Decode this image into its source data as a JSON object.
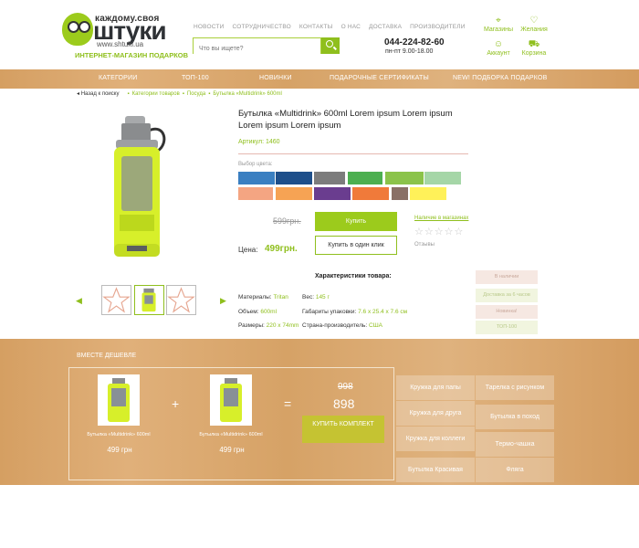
{
  "header": {
    "logo_top": "каждому.своя",
    "logo_main": "штуки",
    "logo_url": "www.shtuki.ua",
    "logo_sub": "ИНТЕРНЕТ-МАГАЗИН ПОДАРКОВ",
    "topnav": [
      "НОВОСТИ",
      "СОТРУДНИЧЕСТВО",
      "КОНТАКТЫ",
      "О НАС",
      "ДОСТАВКА",
      "ПРОИЗВОДИТЕЛИ"
    ],
    "search_placeholder": "Что вы ищете?",
    "phone": "044-224-82-60",
    "hours": "пн-пт 9.00-18.00",
    "icons": [
      {
        "label": "Магазины",
        "icon": "map-pin-icon",
        "glyph": "⌖"
      },
      {
        "label": "Желания",
        "icon": "heart-icon",
        "glyph": "♡"
      },
      {
        "label": "Аккаунт",
        "icon": "user-icon",
        "glyph": "☺"
      },
      {
        "label": "Корзина",
        "icon": "cart-icon",
        "glyph": "⛟"
      }
    ]
  },
  "nav": [
    "КАТЕГОРИИ",
    "ТОП-100",
    "НОВИНКИ",
    "ПОДАРОЧНЫЕ СЕРТИФИКАТЫ",
    "NEW! ПОДБОРКА ПОДАРКОВ"
  ],
  "breadcrumb": {
    "back": "Назад к поиску",
    "items": [
      "Категории товаров",
      "Посуда",
      "Бутылка «Multidrink» 600ml"
    ]
  },
  "product": {
    "title": "Бутылка «Multidrink» 600ml Lorem ipsum Lorem ipsum Lorem ipsum Lorem ipsum",
    "sku": "Артикул: 1460",
    "color_label": "Выбор цвета:",
    "colors": [
      "#3a7fc1",
      "#1e4f8a",
      "#7c7c7c",
      "#4caf50",
      "#8bc34a",
      "#a5d6a7",
      "#f4a582",
      "#f6a354",
      "#6a3d8f",
      "#f07a3a",
      "#8a7066",
      "#fff159"
    ],
    "old_price": "599грн.",
    "price_label": "Цена:",
    "price": "499грн.",
    "buy": "Купить",
    "buy_one_click": "Купить в один клик",
    "wishlist": "Наличие в магазинах",
    "stars": "☆☆☆☆☆",
    "reviews": "Отзывы",
    "char_title": "Характеристики товара:",
    "specs_left": [
      {
        "k": "Материалы:",
        "v": "Tritan"
      },
      {
        "k": "Объем:",
        "v": "600ml"
      },
      {
        "k": "Размеры:",
        "v": "220 x 74mm"
      }
    ],
    "specs_right": [
      {
        "k": "Вес:",
        "v": "145 г"
      },
      {
        "k": "Габариты упаковки:",
        "v": "7.6 x 25.4 x 7.6 см"
      },
      {
        "k": "Страна-производитель:",
        "v": "США"
      }
    ],
    "tags": [
      "В наличии",
      "Доставка за 6 часов",
      "Новинка!",
      "ТОП-100"
    ]
  },
  "bundle": {
    "title": "ВМЕСТЕ ДЕШЕВЛЕ",
    "items": [
      {
        "caption": "Бутылка «Multidrink» 600ml",
        "price": "499 грн"
      },
      {
        "caption": "Бутылка «Multidrink» 600ml",
        "price": "499 грн"
      }
    ],
    "plus": "+",
    "equals": "=",
    "old_total": "998",
    "new_total": "898",
    "buy_kit": "КУПИТЬ КОМПЛЕКТ",
    "related": [
      "Кружка для папы",
      "Тарелка с рисунком",
      "Кружка для друга",
      "Бутылка в поход",
      "Кружка для коллеги",
      "Термо-чашка",
      "Бутылка Красивая",
      "Фляга"
    ]
  }
}
